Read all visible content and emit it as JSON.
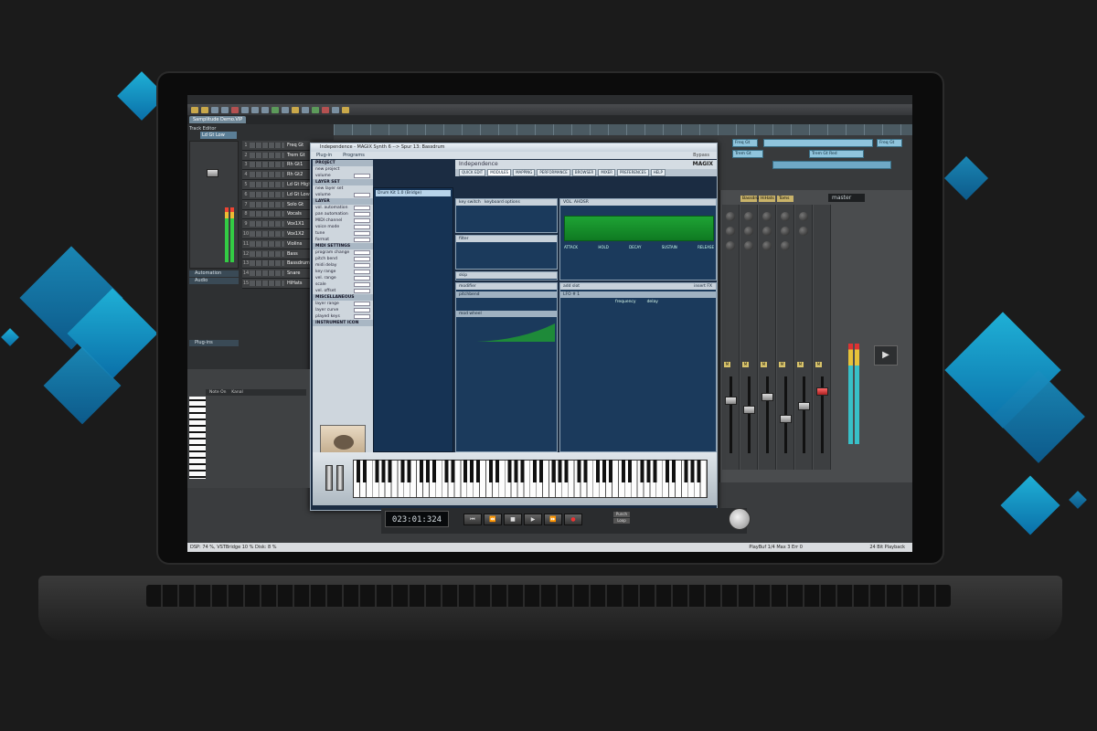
{
  "daw": {
    "project_tab": "Samplitude Demo.VIP",
    "track_editor_title": "Track Editor",
    "selected_track": "Ld Gt Low",
    "sections": [
      "Automation",
      "Audio",
      "Plug-ins"
    ],
    "tracks": [
      {
        "num": "1",
        "name": "Freq Gt"
      },
      {
        "num": "2",
        "name": "Trem Gt"
      },
      {
        "num": "3",
        "name": "Rh Gt1"
      },
      {
        "num": "4",
        "name": "Rh Gt2"
      },
      {
        "num": "5",
        "name": "Ld Gt High"
      },
      {
        "num": "6",
        "name": "Ld Gt Low"
      },
      {
        "num": "7",
        "name": "Solo Gt"
      },
      {
        "num": "8",
        "name": "Vocals"
      },
      {
        "num": "9",
        "name": "Vox1X1"
      },
      {
        "num": "10",
        "name": "Vox1X2"
      },
      {
        "num": "11",
        "name": "Violins"
      },
      {
        "num": "12",
        "name": "Bass"
      },
      {
        "num": "13",
        "name": "Bassdrum"
      },
      {
        "num": "14",
        "name": "Snare"
      },
      {
        "num": "15",
        "name": "HiHats"
      }
    ],
    "clips": [
      {
        "label": "Freq Gt"
      },
      {
        "label": "Freq Gt"
      },
      {
        "label": "Trem Gt"
      },
      {
        "label": "Trem Gt Red"
      }
    ],
    "piano_roll": {
      "label": "Note On",
      "sub": "Kanal"
    },
    "mixer": {
      "headers": [
        "Bassdrum",
        "HiHats",
        "Toms"
      ],
      "master_label": "master"
    },
    "transport": {
      "time": "023:01:324",
      "buttons": [
        "⏮",
        "⏪",
        "■",
        "▶",
        "⏩",
        "●"
      ],
      "loop": [
        "Punch",
        "Loop"
      ]
    },
    "status": {
      "left": "DSP: 74 %, VSTBridge 10 %    Disk: 8 %",
      "mid": "PlayBuf 1/4  Max 3  Err 0",
      "right": "24 Bit Playback"
    }
  },
  "plugin": {
    "title": "Independence - MAGIX Synth 6  -->  Spur 13: Bassdrum",
    "menu": [
      "Plug-in",
      "Programs"
    ],
    "bypass": "Bypass",
    "brand": "Independence",
    "magix": "MAGIX",
    "tabs": [
      "QUICK EDIT",
      "MODULES",
      "MAPPING",
      "PERFORMANCE",
      "BROWSER",
      "MIXER",
      "PREFERENCES",
      "HELP"
    ],
    "left_sections": [
      {
        "head": "PROJECT",
        "rows": [
          "new project",
          "volume"
        ]
      },
      {
        "head": "LAYER SET",
        "rows": [
          "new layer set",
          "volume"
        ]
      },
      {
        "head": "LAYER",
        "rows": [
          "vol. automation",
          "pan automation",
          "MIDI channel",
          "voice mode",
          "tune",
          "format"
        ]
      },
      {
        "head": "MIDI SETTINGS",
        "rows": [
          "program change",
          "pitch bend",
          "midi delay",
          "key range",
          "vel. range",
          "scale",
          "vel. offset"
        ]
      },
      {
        "head": "MISCELLANEOUS",
        "rows": [
          "layer range",
          "layer curve",
          "played keys"
        ]
      },
      {
        "head": "INSTRUMENT ICON",
        "rows": []
      }
    ],
    "layer_item": "Drum Kit 1.0 (Bridge)",
    "panels": {
      "key_switch": "key switch",
      "keyboard_options": "keyboard options",
      "filter": "filter",
      "skip": "skip",
      "modifier": "modifier",
      "pitchbend": "pitchbend",
      "mod_wheel": "mod wheel",
      "vol_ahdsr": "VOL. AHDSR",
      "envelope_labels": [
        "ATTACK",
        "HOLD",
        "DECAY",
        "SUSTAIN",
        "RELEASE"
      ],
      "lfo": "LFO # 1",
      "lfo_rows": [
        "frequency",
        "delay"
      ],
      "add_slot": "add slot",
      "insert_fx": "insert FX"
    }
  },
  "colors": {
    "accent_teal": "#1fb0d6",
    "clip_blue": "#8fc4dc",
    "env_green": "#1ea334",
    "plugin_bg": "#1b2c42"
  }
}
